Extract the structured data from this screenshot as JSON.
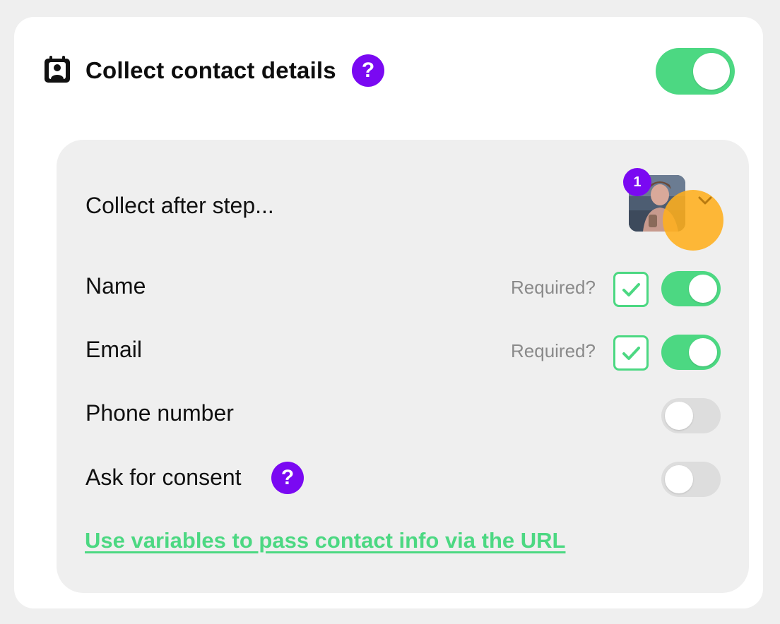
{
  "header": {
    "title": "Collect contact details",
    "help_glyph": "?",
    "enabled": true,
    "icon": "contact-card-icon"
  },
  "panel": {
    "collect_after": {
      "label": "Collect after step...",
      "step_number": "1",
      "thumbnail": "video-thumbnail"
    },
    "fields": [
      {
        "label": "Name",
        "required_label": "Required?",
        "required": true,
        "enabled": true
      },
      {
        "label": "Email",
        "required_label": "Required?",
        "required": true,
        "enabled": true
      },
      {
        "label": "Phone number",
        "enabled": false
      },
      {
        "label": "Ask for consent",
        "help_glyph": "?",
        "enabled": false
      }
    ],
    "link_text": "Use variables to pass contact info via the URL"
  },
  "colors": {
    "accent_green": "#4cd882",
    "accent_purple": "#7a09f2",
    "dropdown_highlight": "#ffaf1e"
  }
}
